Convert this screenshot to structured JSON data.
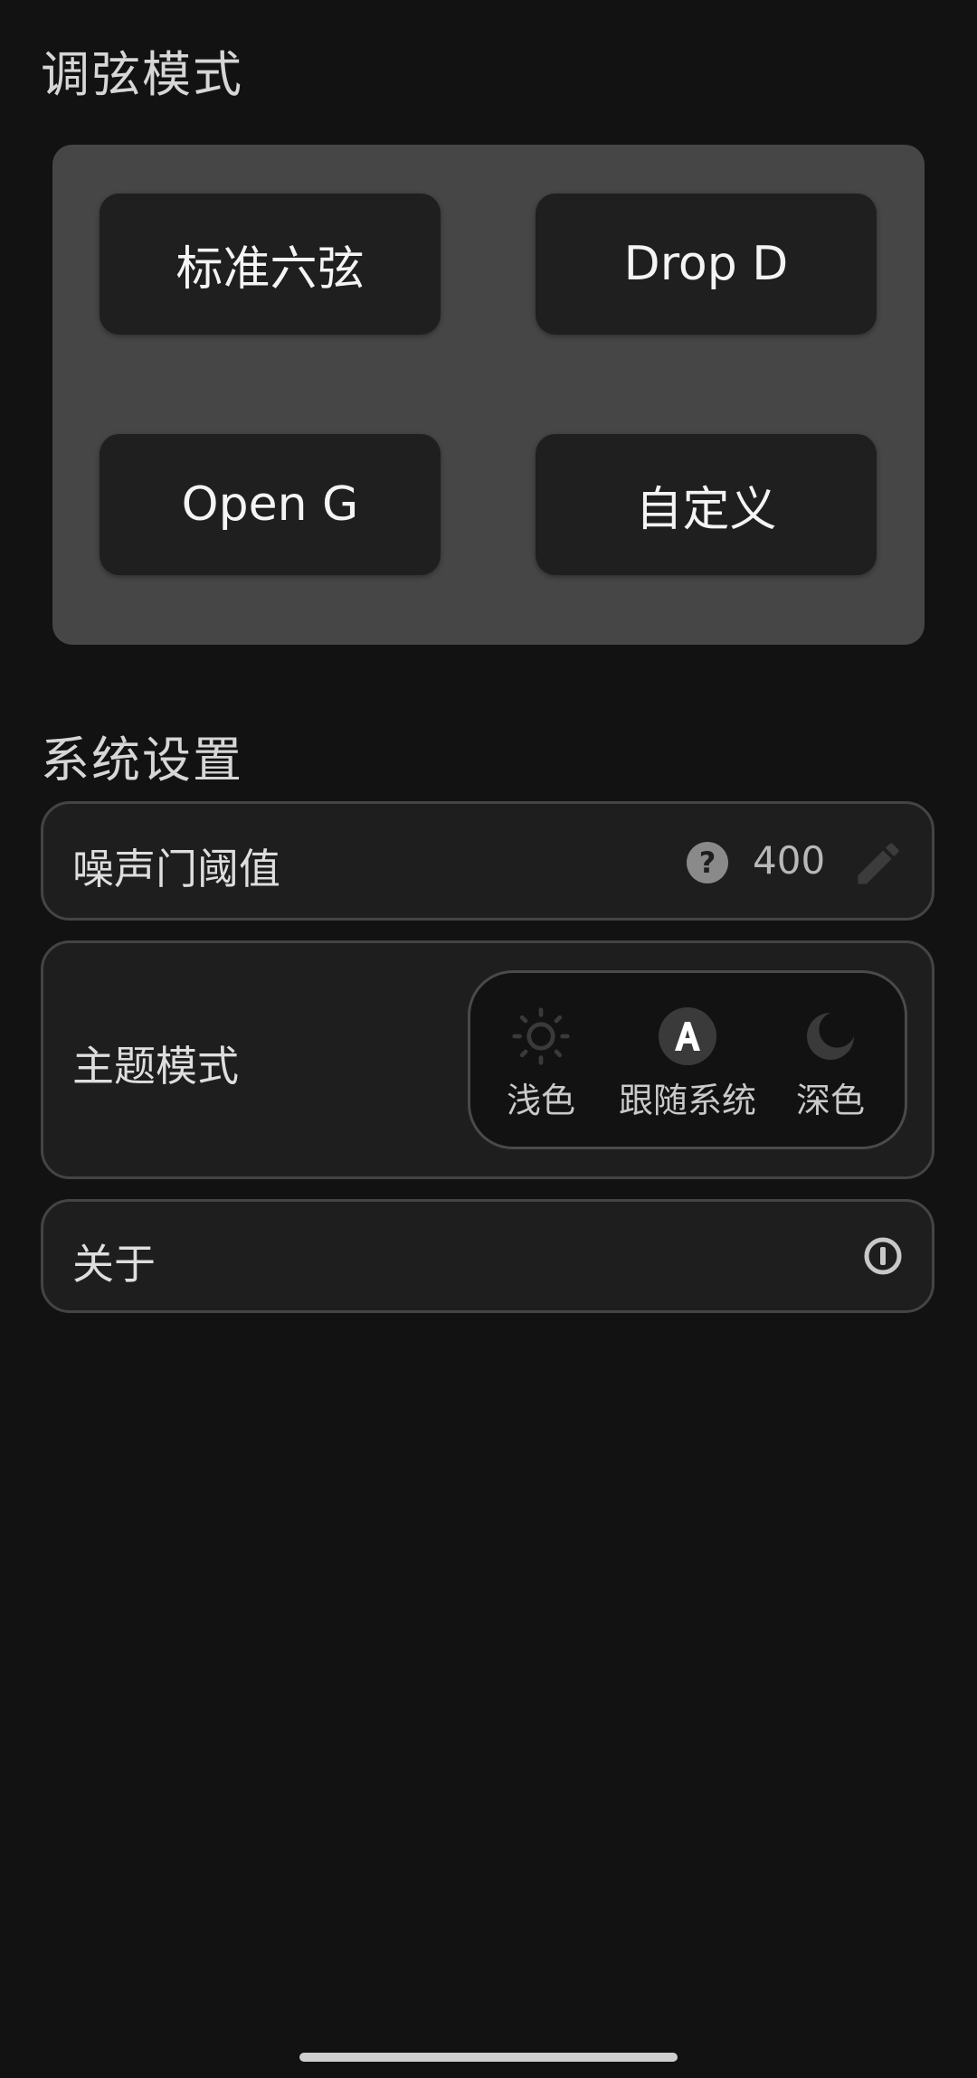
{
  "tuning": {
    "title": "调弦模式",
    "buttons": [
      {
        "label": "标准六弦"
      },
      {
        "label": "Drop D"
      },
      {
        "label": "Open G"
      },
      {
        "label": "自定义"
      }
    ]
  },
  "system": {
    "title": "系统设置",
    "noise_gate": {
      "label": "噪声门阈值",
      "help_icon": "question-circle-icon",
      "value": "400",
      "edit_icon": "pencil-icon"
    },
    "theme": {
      "label": "主题模式",
      "options": [
        {
          "label": "浅色",
          "icon": "sun-icon"
        },
        {
          "label": "跟随系统",
          "icon": "auto-theme-icon",
          "selected": true
        },
        {
          "label": "深色",
          "icon": "moon-icon"
        }
      ]
    },
    "about": {
      "label": "关于",
      "icon": "info-circle-icon"
    }
  },
  "colors": {
    "background": "#121212",
    "panel": "#464646",
    "button": "#1f1f1f",
    "card": "#1e1e1e",
    "card_border": "#444444"
  }
}
